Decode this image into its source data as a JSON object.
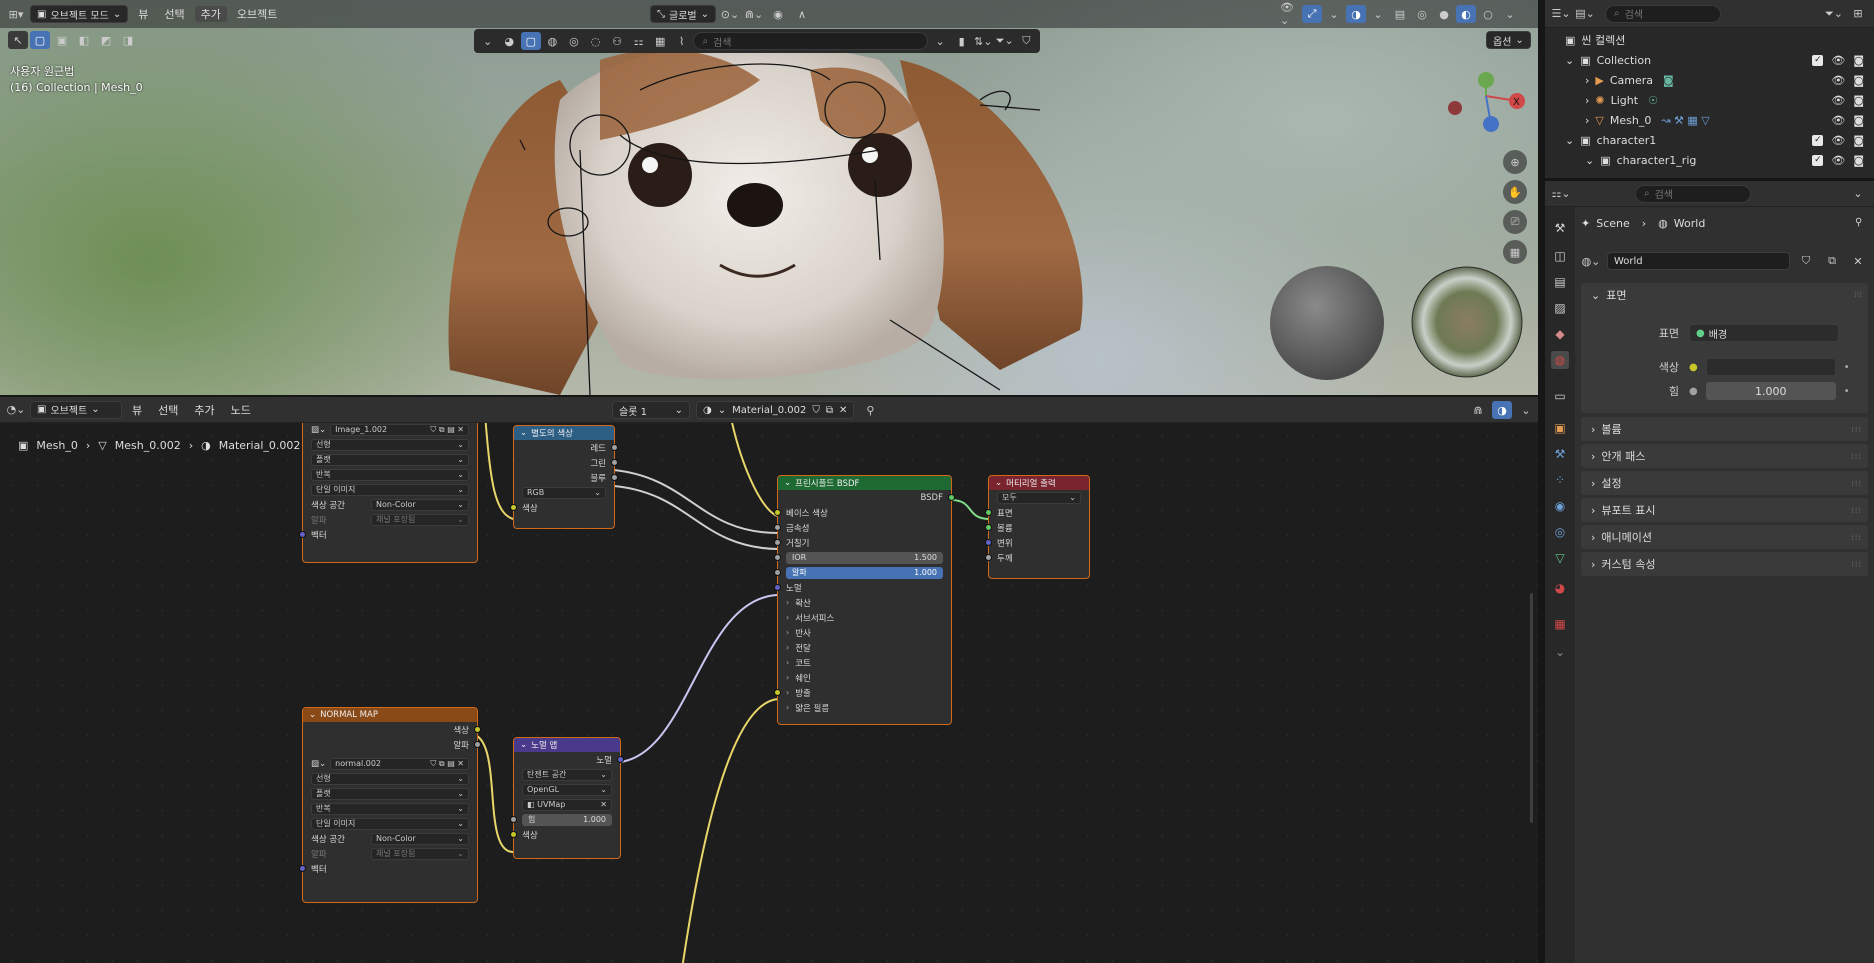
{
  "viewport": {
    "editor_icon": "3d-viewport-icon",
    "mode": "오브젝트 모드",
    "menus": [
      "뷰",
      "선택",
      "추가",
      "오브젝트"
    ],
    "active_menu": "추가",
    "transform_orientation": "글로벌",
    "options_label": "옵션",
    "search_placeholder": "검색",
    "overlay_title": "사용자 원근법",
    "overlay_subtitle": "(16) Collection | Mesh_0"
  },
  "node_editor": {
    "type": "오브젝트",
    "menus": [
      "뷰",
      "선택",
      "추가",
      "노드"
    ],
    "slot": "슬롯 1",
    "material": "Material_0.002",
    "breadcrumb": [
      "Mesh_0",
      "Mesh_0.002",
      "Material_0.002"
    ],
    "nodes": {
      "image1": {
        "image_name": "Image_1.002",
        "dropdowns": [
          "선형",
          "플랫",
          "반복",
          "단일 이미지"
        ],
        "color_space_label": "색상 공간",
        "color_space": "Non-Color",
        "alpha_label": "알파",
        "alpha_value": "채널 포장됨",
        "vector_label": "벡터"
      },
      "separate": {
        "title": "별도의 색상",
        "outputs": [
          "레드",
          "그린",
          "블루"
        ],
        "mode": "RGB",
        "input": "색상"
      },
      "bsdf": {
        "title": "프린시플드 BSDF",
        "output": "BSDF",
        "inputs": [
          "베이스 색상",
          "금속성",
          "거칠기"
        ],
        "ior_label": "IOR",
        "ior_value": "1.500",
        "alpha_label": "알파",
        "alpha_value": "1.000",
        "normal": "노멀",
        "panels": [
          "확산",
          "서브서피스",
          "반사",
          "전달",
          "코트",
          "쉐인",
          "방출",
          "얇은 필름"
        ]
      },
      "output": {
        "title": "머티리얼 출력",
        "target": "모두",
        "inputs": [
          "표면",
          "볼륨",
          "변위",
          "두께"
        ]
      },
      "normal_tex": {
        "title": "NORMAL MAP",
        "outputs": [
          "색상",
          "알파"
        ],
        "image_name": "normal.002",
        "dropdowns": [
          "선형",
          "플랫",
          "반복",
          "단일 이미지"
        ],
        "color_space_label": "색상 공간",
        "color_space": "Non-Color",
        "alpha_label": "알파",
        "alpha_value": "채널 포장됨",
        "vector_label": "벡터"
      },
      "normal_map": {
        "title": "노멀 맵",
        "output": "노멀",
        "space": "탄젠트 공간",
        "convention": "OpenGL",
        "uv": "UVMap",
        "strength_label": "힘",
        "strength_value": "1.000",
        "input": "색상"
      }
    }
  },
  "outliner": {
    "search_placeholder": "검색",
    "scene_collection": "씬 컬렉션",
    "items": [
      {
        "label": "Collection",
        "icon": "collection-icon"
      },
      {
        "label": "Camera",
        "icon": "camera-icon"
      },
      {
        "label": "Light",
        "icon": "light-icon"
      },
      {
        "label": "Mesh_0",
        "icon": "mesh-icon"
      },
      {
        "label": "character1",
        "icon": "collection-icon"
      },
      {
        "label": "character1_rig",
        "icon": "collection-icon"
      }
    ]
  },
  "properties": {
    "search_placeholder": "검색",
    "breadcrumb_scene": "Scene",
    "breadcrumb_world": "World",
    "world_name": "World",
    "surface_section": "표면",
    "surface_label": "표면",
    "surface_value": "배경",
    "color_label": "색상",
    "strength_label": "힘",
    "strength_value": "1.000",
    "sections": [
      "볼륨",
      "안개 패스",
      "설정",
      "뷰포트 표시",
      "애니메이션",
      "커스텀 속성"
    ]
  },
  "colors": {
    "accent": "#4772b3",
    "node_border": "#d06a1a",
    "bsdf_header": "#1f6a33",
    "output_header": "#7a2430",
    "separate_header": "#2d5f85",
    "normal_map_header": "#4a3a8c",
    "texture_header": "#8a4a18"
  }
}
